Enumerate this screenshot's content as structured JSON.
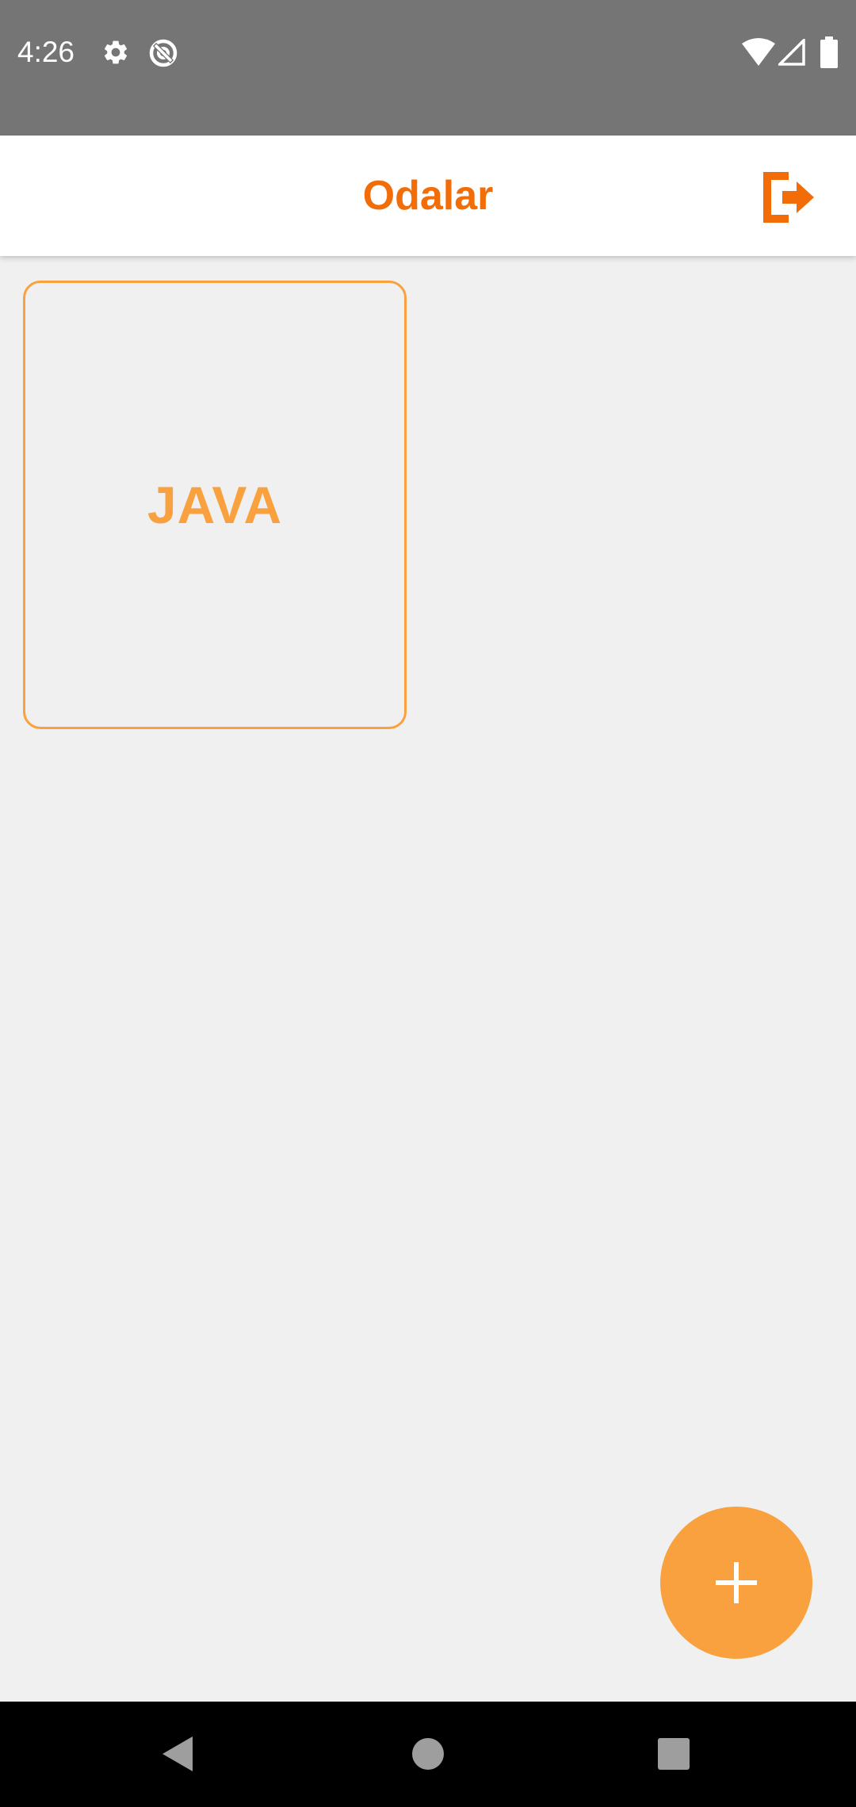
{
  "status_bar": {
    "time": "4:26",
    "icons": [
      "settings-gear-icon",
      "data-saver-icon",
      "wifi-icon",
      "cellular-signal-icon",
      "battery-icon"
    ]
  },
  "app_bar": {
    "title": "Odalar",
    "logout_icon": "logout-exit-icon"
  },
  "rooms": [
    {
      "name": "JAVA"
    }
  ],
  "fab": {
    "icon": "plus-icon"
  },
  "nav_bar": {
    "icons": [
      "back-triangle-icon",
      "home-circle-icon",
      "recents-square-icon"
    ]
  },
  "colors": {
    "accent_dark": "#f26c07",
    "accent_light": "#f9a13e",
    "status_bar": "#757575",
    "background": "#f0f0f0"
  }
}
